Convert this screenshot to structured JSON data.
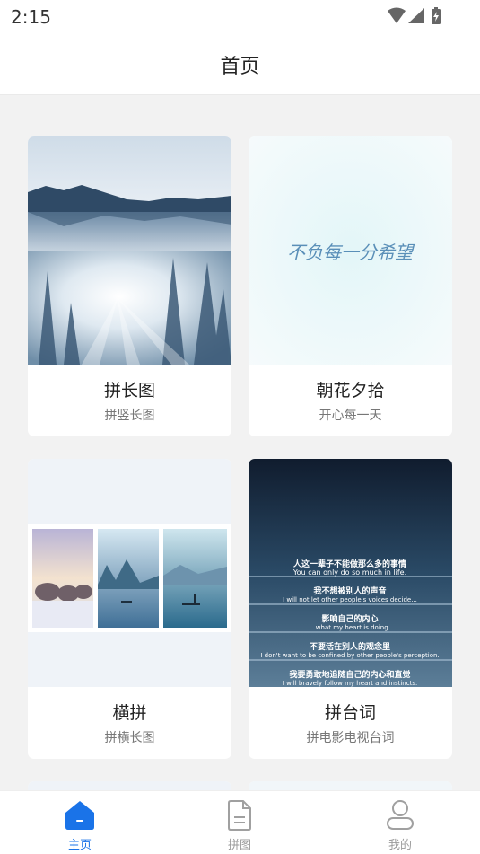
{
  "status": {
    "time": "2:15"
  },
  "header": {
    "title": "首页"
  },
  "cards": [
    {
      "title": "拼长图",
      "subtitle": "拼竖长图"
    },
    {
      "title": "朝花夕拾",
      "subtitle": "开心每一天",
      "image_text": "不负每一分希望"
    },
    {
      "title": "横拼",
      "subtitle": "拼横长图"
    },
    {
      "title": "拼台词",
      "subtitle": "拼电影电视台词",
      "subtitles": [
        {
          "zh": "人这一辈子不能做那么多的事情",
          "en": "You can only do so much in life."
        },
        {
          "zh": "我不想被别人的声音",
          "en": "I will not let other people's voices decide..."
        },
        {
          "zh": "影响自己的内心",
          "en": "...what my heart is doing."
        },
        {
          "zh": "不要活在别人的观念里",
          "en": "I don't want to be confined by other people's perception."
        },
        {
          "zh": "我要勇敢地追随自己的内心和直觉",
          "en": "I will bravely follow my heart and instincts."
        }
      ]
    }
  ],
  "tabbar": {
    "items": [
      {
        "label": "主页",
        "active": true
      },
      {
        "label": "拼图",
        "active": false
      },
      {
        "label": "我的",
        "active": false
      }
    ]
  },
  "colors": {
    "accent": "#1a73e8",
    "background": "#f2f2f2",
    "inactive": "#9a9a9a"
  },
  "icons": [
    "wifi-icon",
    "signal-icon",
    "battery-icon",
    "home-icon",
    "document-icon",
    "user-icon"
  ]
}
